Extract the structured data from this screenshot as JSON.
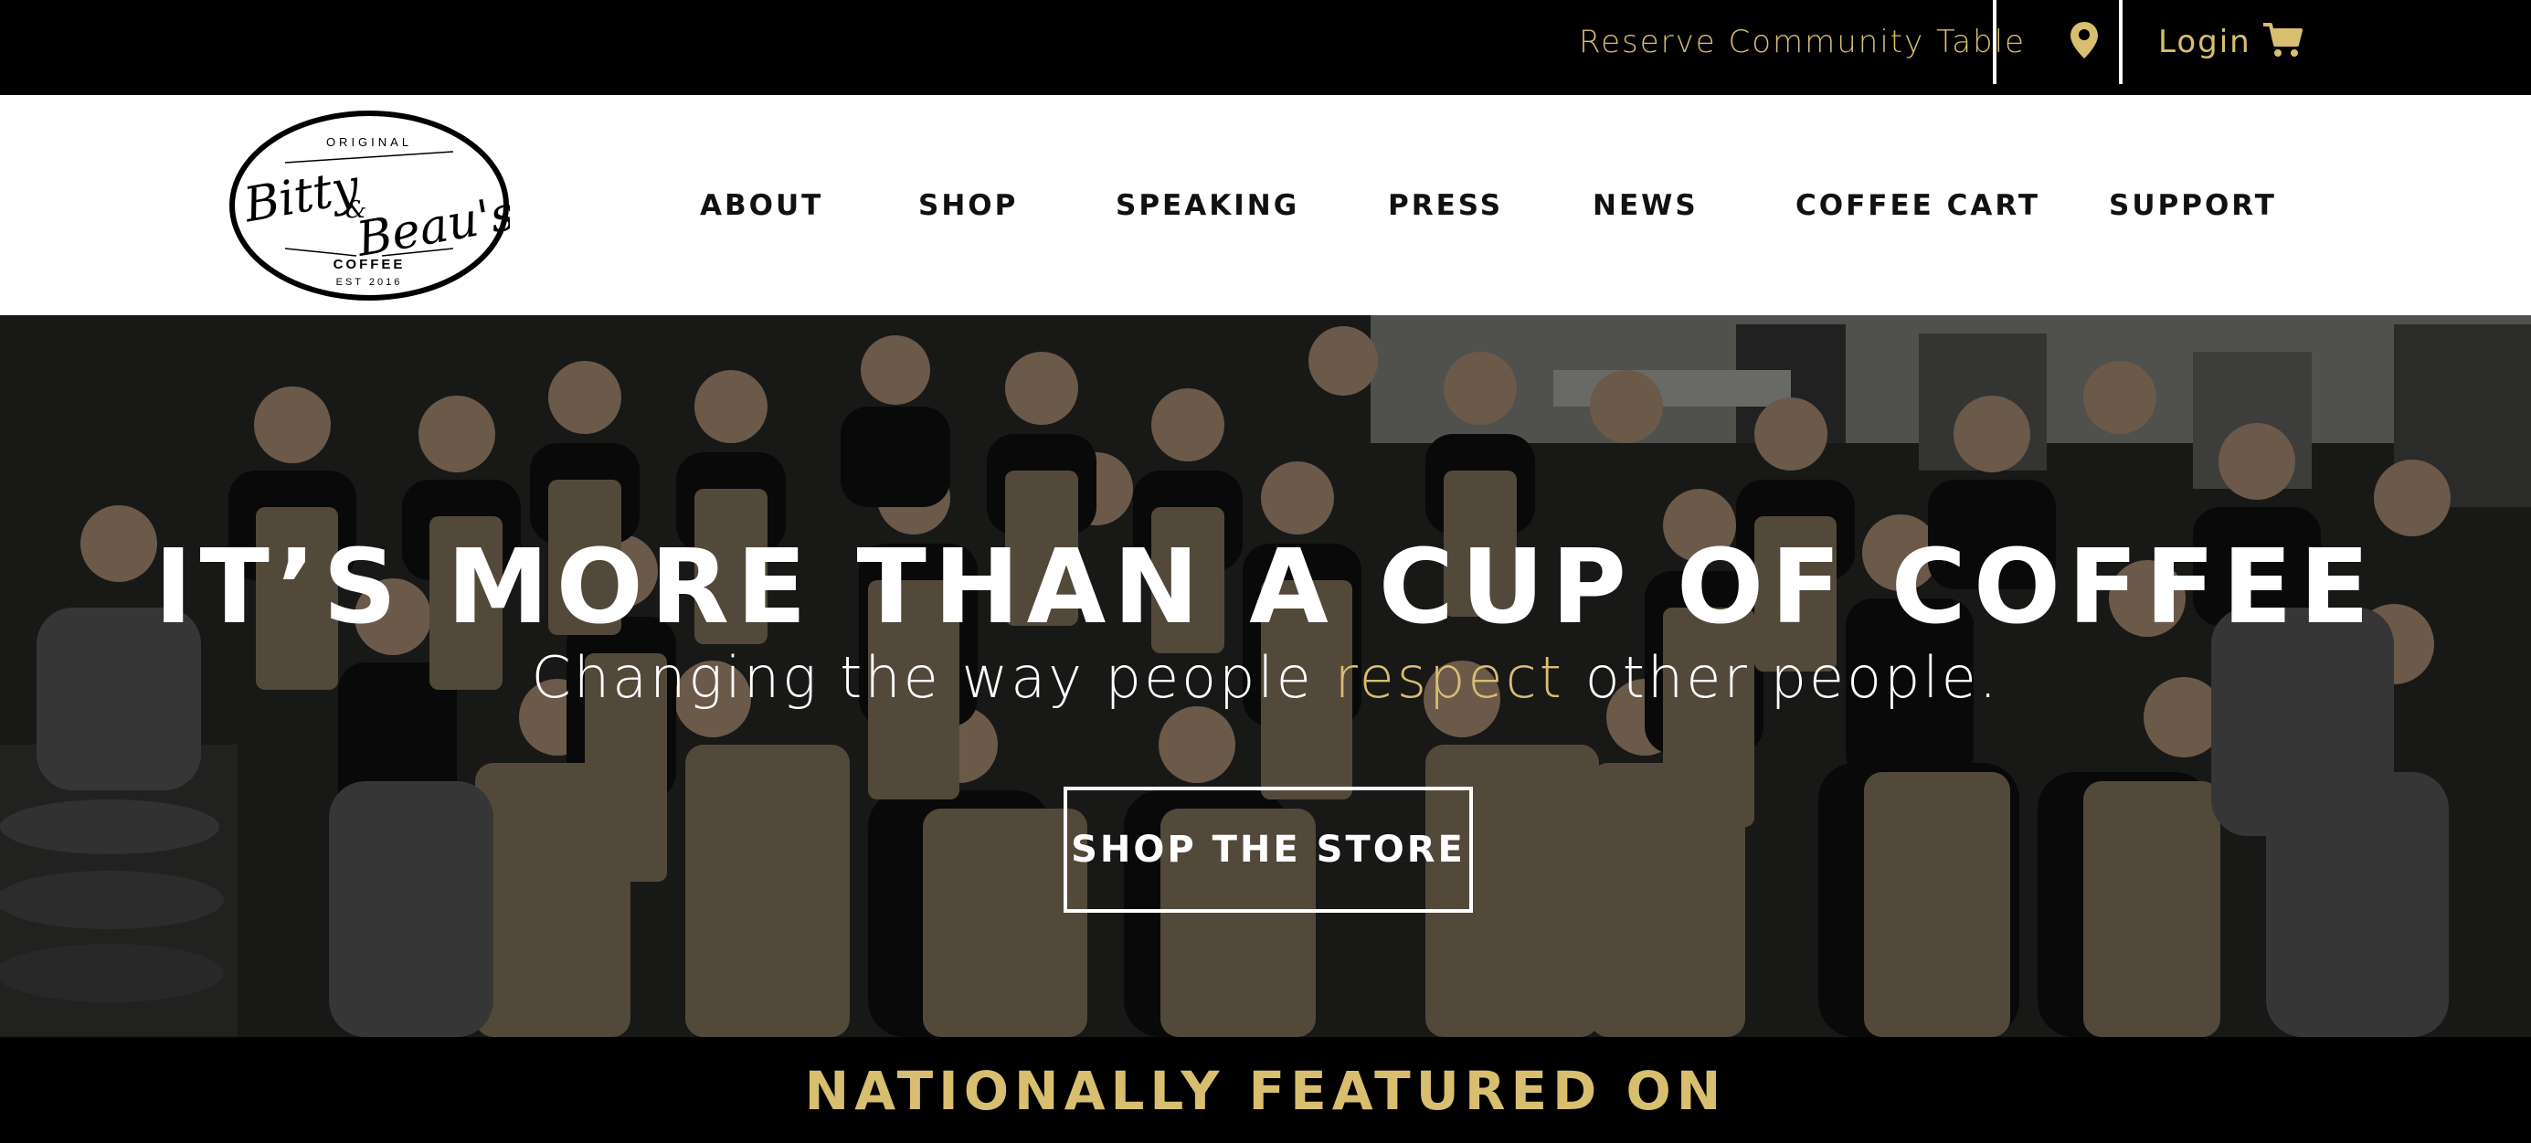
{
  "topbar": {
    "reserve_label": "Reserve Community Table",
    "location_icon": "map-pin-icon",
    "login_label": "Login",
    "cart_icon": "shopping-cart-icon"
  },
  "logo": {
    "top_text": "ORIGINAL",
    "name_part1": "Bitty",
    "ampersand": "&",
    "name_part2": "Beau's",
    "coffee_text": "COFFEE",
    "est_text": "EST 2016"
  },
  "nav": {
    "items": [
      {
        "label": "ABOUT"
      },
      {
        "label": "SHOP"
      },
      {
        "label": "SPEAKING"
      },
      {
        "label": "PRESS"
      },
      {
        "label": "NEWS"
      },
      {
        "label": "COFFEE CART"
      },
      {
        "label": "SUPPORT"
      }
    ]
  },
  "hero": {
    "title": "IT’S MORE THAN A CUP OF COFFEE",
    "subtitle_before": "Changing the way people ",
    "subtitle_accent": "respect",
    "subtitle_after": " other people.",
    "button_label": "SHOP THE STORE"
  },
  "featured": {
    "heading": "NATIONALLY FEATURED ON"
  },
  "colors": {
    "gold": "#d8be6f",
    "black": "#000000",
    "white": "#ffffff",
    "nav_text": "#111111"
  }
}
